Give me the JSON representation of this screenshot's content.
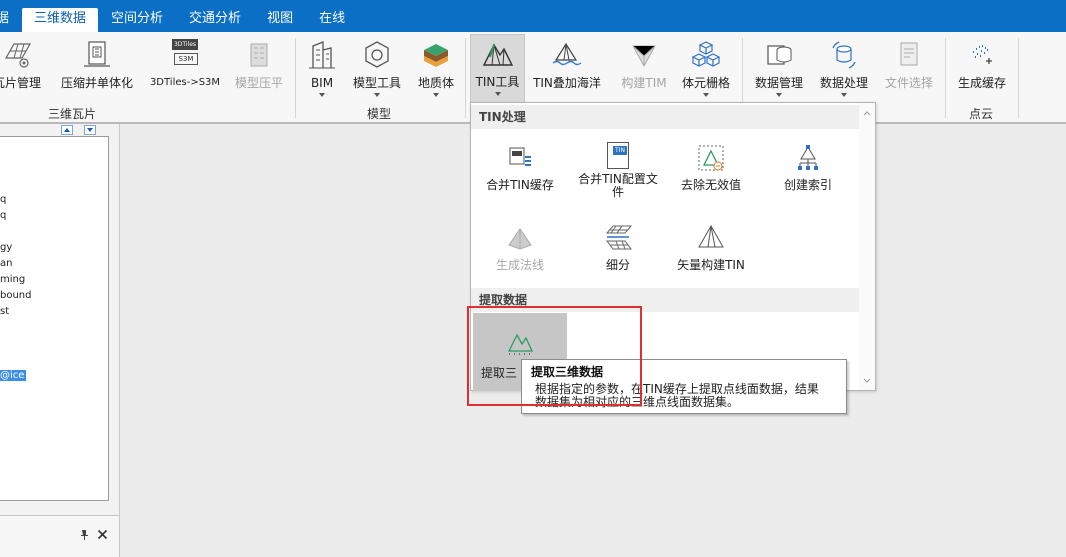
{
  "menubar": {
    "items": [
      "据",
      "三维数据",
      "空间分析",
      "交通分析",
      "视图",
      "在线"
    ],
    "active_index": 1
  },
  "ribbon": {
    "buttons": {
      "tile_manage": "瓦片管理",
      "compress_merge": "压缩并单体化",
      "tiles_to_s3m": "3DTiles->S3M",
      "tiles_icon_top": "3DTiles",
      "tiles_icon_bottom": "S3M",
      "model_flatten": "模型压平",
      "bim": "BIM",
      "model_tools": "模型工具",
      "geology": "地质体",
      "tin_tools": "TIN工具",
      "tin_ocean": "TIN叠加海洋",
      "build_tim": "构建TIM",
      "voxel_grid": "体元栅格",
      "data_manage": "数据管理",
      "data_process": "数据处理",
      "file_select": "文件选择",
      "gen_cache": "生成缓存"
    },
    "groups": {
      "tiles": "三维瓦片",
      "model": "模型",
      "point_cloud": "点云"
    }
  },
  "tree": {
    "items": [
      "q",
      "q",
      "gy",
      "an",
      "ming",
      "bound",
      "st",
      "@ice"
    ],
    "selected_index": 7
  },
  "dropdown": {
    "sections": {
      "tin_process": "TIN处理",
      "extract": "提取数据"
    },
    "items": {
      "merge_tin_cache": "合并TIN缓存",
      "merge_tin_config": "合并TIN配置文件",
      "merge_tin_config_icon": "TIN",
      "remove_invalid": "去除无效值",
      "create_index": "创建索引",
      "gen_normals": "生成法线",
      "subdivide": "细分",
      "vector_build_tin": "矢量构建TIN",
      "extract_3d": "提取三"
    }
  },
  "tooltip": {
    "title": "提取三维数据",
    "desc_line1": "根据指定的参数，在TIN缓存上提取点线面数据，结果",
    "desc_line2": "数据集为相对应的三维点线面数据集。"
  },
  "colors": {
    "menubar_bg": "#0b6fc6",
    "highlight_box": "#e0302d",
    "tree_selection": "#3d8ee8"
  }
}
